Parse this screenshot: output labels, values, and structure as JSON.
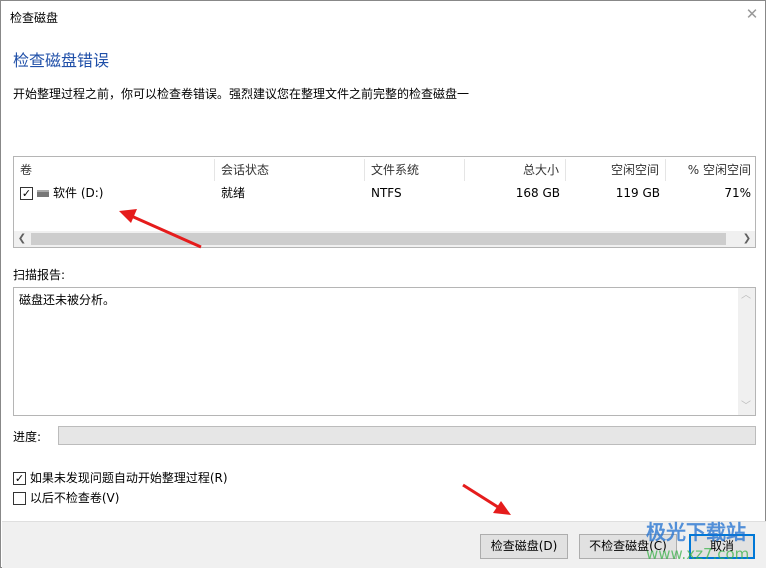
{
  "window": {
    "title": "检查磁盘",
    "close_icon": "close-icon"
  },
  "heading": "检查磁盘错误",
  "description": "开始整理过程之前，你可以检查卷错误。强烈建议您在整理文件之前完整的检查磁盘一",
  "volumes": {
    "columns": [
      "卷",
      "会话状态",
      "文件系统",
      "总大小",
      "空闲空间",
      "% 空闲空间"
    ],
    "rows": [
      {
        "checked": true,
        "name": "软件 (D:)",
        "status": "就绪",
        "fs": "NTFS",
        "total": "168 GB",
        "free": "119 GB",
        "pct": "71%"
      }
    ]
  },
  "report": {
    "label": "扫描报告:",
    "text": "磁盘还未被分析。"
  },
  "progress": {
    "label": "进度:",
    "value": 0
  },
  "options": [
    {
      "label": "如果未发现问题自动开始整理过程(R)",
      "checked": true
    },
    {
      "label": "以后不检查卷(V)",
      "checked": false
    }
  ],
  "buttons": {
    "check": "检查磁盘(D)",
    "skip": "不检查磁盘(C)",
    "cancel": "取消"
  },
  "watermark": {
    "name": "极光下载站",
    "url": "www.xz7.com"
  },
  "colors": {
    "heading": "#1f4fa8",
    "default_button_border": "#0078d7",
    "arrow": "#e51c1c"
  }
}
